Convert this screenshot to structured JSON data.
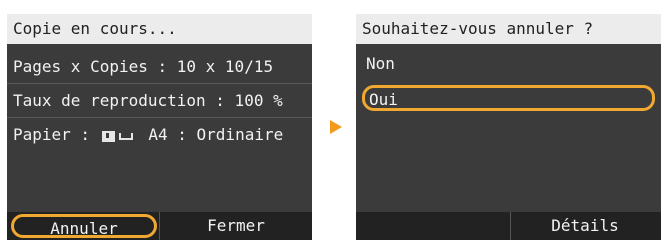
{
  "left_screen": {
    "title": "Copie en cours...",
    "rows": [
      "Pages x Copies : 10 x 10/15",
      "Taux de reproduction : 100 %"
    ],
    "paper": {
      "prefix": "Papier :",
      "size": "A4",
      "separator": ":",
      "type": "Ordinaire"
    },
    "buttons": {
      "cancel": "Annuler",
      "close": "Fermer"
    }
  },
  "right_screen": {
    "title": "Souhaitez-vous annuler ?",
    "options": [
      "Non",
      "Oui"
    ],
    "buttons": {
      "details": "Détails"
    }
  },
  "colors": {
    "highlight": "#f0a830",
    "arrow": "#f29a1e"
  },
  "icons": [
    "paper-cassette-icon",
    "paper-tray-icon",
    "next-arrow-icon"
  ]
}
